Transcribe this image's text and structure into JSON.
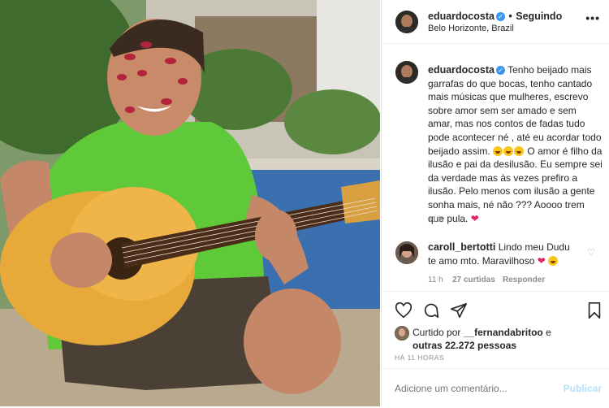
{
  "header": {
    "username": "eduardocosta",
    "follow_sep": "•",
    "follow_label": "Seguindo",
    "location": "Belo Horizonte, Brazil",
    "more_label": "•••"
  },
  "caption": {
    "username": "eduardocosta",
    "text_1": "Tenho beijado mais garrafas do que bocas, tenho cantado mais músicas que mulheres, escrevo sobre amor sem ser amado e sem amar, mas nos contos de fadas tudo pode acontecer né , até eu acordar todo beijado assim.",
    "text_2": "O amor é filho da ilusão e pai da desilusão. Eu sempre sei da verdade mas às vezes prefiro a ilusão. Pelo menos com ilusão a gente sonha mais, né não ??? Aoooo trem que pula.",
    "time": "11 h"
  },
  "comment": {
    "username": "caroll_bertotti",
    "text": "Lindo meu Dudu te amo mto. Maravilhoso",
    "time": "11 h",
    "likes": "27 curtidas",
    "reply": "Responder"
  },
  "liked_by": {
    "prefix": "Curtido por",
    "user": "__fernandabritoo",
    "connector": "e",
    "others": "outras 22.272 pessoas"
  },
  "timestamp": "HÁ 11 HORAS",
  "add_comment": {
    "placeholder": "Adicione um comentário...",
    "publish": "Publicar"
  },
  "colors": {
    "verified": "#3897f0",
    "heart": "#e0245e",
    "publish_disabled": "#b2dffc"
  }
}
